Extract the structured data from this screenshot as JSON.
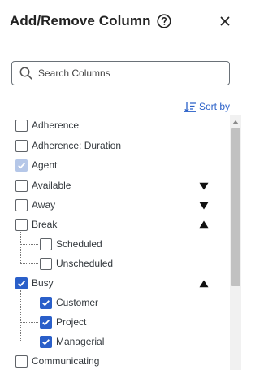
{
  "header": {
    "title": "Add/Remove Column"
  },
  "search": {
    "placeholder": "Search Columns",
    "value": ""
  },
  "sort": {
    "label": "Sort by"
  },
  "columns": {
    "adherence": {
      "label": "Adherence",
      "checked": false
    },
    "adherence_duration": {
      "label": "Adherence: Duration",
      "checked": false
    },
    "agent": {
      "label": "Agent",
      "checked": true,
      "disabled": true
    },
    "available": {
      "label": "Available",
      "checked": false,
      "expander": "collapsed"
    },
    "away": {
      "label": "Away",
      "checked": false,
      "expander": "collapsed"
    },
    "break": {
      "label": "Break",
      "checked": false,
      "expander": "expanded"
    },
    "scheduled": {
      "label": "Scheduled",
      "checked": false
    },
    "unscheduled": {
      "label": "Unscheduled",
      "checked": false
    },
    "busy": {
      "label": "Busy",
      "checked": true,
      "expander": "expanded"
    },
    "customer": {
      "label": "Customer",
      "checked": true
    },
    "project": {
      "label": "Project",
      "checked": true
    },
    "managerial": {
      "label": "Managerial",
      "checked": true
    },
    "communicating": {
      "label": "Communicating",
      "checked": false
    }
  },
  "colors": {
    "accent": "#2a5fc9",
    "link": "#2a60c8"
  }
}
